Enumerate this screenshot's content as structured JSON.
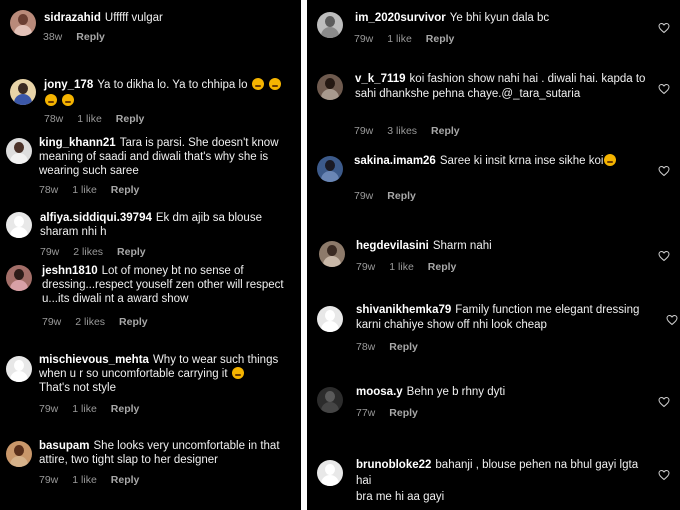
{
  "left": [
    {
      "user": "sidrazahid",
      "text": "Ufffff vulgar",
      "time": "38w",
      "likes": "",
      "reply": "Reply"
    },
    {
      "user": "jony_178",
      "text": "Ya to dikha lo. Ya to chhipa lo",
      "time": "78w",
      "likes": "1 like",
      "reply": "Reply"
    },
    {
      "user": "king_khann21",
      "text": "Tara is parsi. She doesn't know meaning of saadi and diwali that's why she is wearing such saree",
      "time": "78w",
      "likes": "1 like",
      "reply": "Reply"
    },
    {
      "user": "alfiya.siddiqui.39794",
      "text": "Ek dm ajib sa blouse sharam nhi h",
      "time": "79w",
      "likes": "2 likes",
      "reply": "Reply"
    },
    {
      "user": "jeshn1810",
      "text": "Lot of money bt no sense of dressing...respect youself zen other will respect u...its diwali nt a award show",
      "time": "79w",
      "likes": "2 likes",
      "reply": "Reply"
    },
    {
      "user": "mischievous_mehta",
      "text": "Why to wear such things when u r so uncomfortable carrying it",
      "text2": "That's not style",
      "time": "79w",
      "likes": "1 like",
      "reply": "Reply"
    },
    {
      "user": "basupam",
      "text": "She looks very uncomfortable in that attire,  two tight slap to her designer",
      "time": "79w",
      "likes": "1 like",
      "reply": "Reply"
    }
  ],
  "right": [
    {
      "user": "im_2020survivor",
      "text": "Ye bhi kyun dala bc",
      "time": "79w",
      "likes": "1 like",
      "reply": "Reply"
    },
    {
      "user": "v_k_7119",
      "text": "koi fashion show nahi hai . diwali hai. kapda to sahi dhankshe pehna chaye.@_tara_sutaria",
      "time": "79w",
      "likes": "3 likes",
      "reply": "Reply"
    },
    {
      "user": "sakina.imam26",
      "text": "Saree ki insit krna inse sikhe koi",
      "time": "79w",
      "likes": "",
      "reply": "Reply"
    },
    {
      "user": "hegdevilasini",
      "text": "Sharm nahi",
      "time": "79w",
      "likes": "1 like",
      "reply": "Reply"
    },
    {
      "user": "shivanikhemka79",
      "text": "Family function me elegant dressing karni chahiye show off nhi look cheap",
      "time": "78w",
      "likes": "",
      "reply": "Reply"
    },
    {
      "user": "moosa.y",
      "text": "Behn ye b rhny dyti",
      "time": "77w",
      "likes": "",
      "reply": "Reply"
    },
    {
      "user": "brunobloke22",
      "text": "bahanji , blouse pehen na bhul gayi lgta hai",
      "text2": "bra me hi aa gayi",
      "time": "",
      "likes": "",
      "reply": ""
    }
  ],
  "icons": {
    "like": "heart-outline-icon"
  }
}
